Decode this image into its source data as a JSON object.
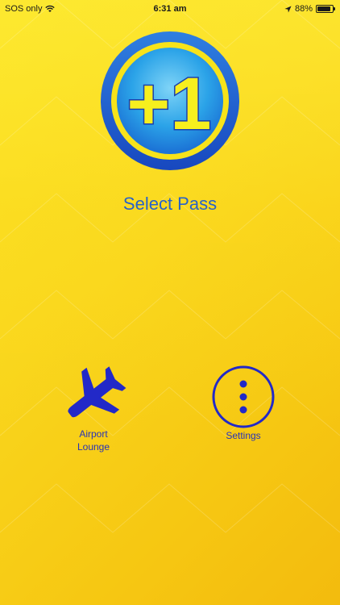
{
  "status_bar": {
    "carrier": "SOS only",
    "time": "6:31 am",
    "battery_percent": "88%",
    "battery_level": 0.88
  },
  "logo": {
    "text": "+1",
    "colors": {
      "ring_outer": "#1e5fd0",
      "ring_mid": "#f7e31a",
      "inner": "#2ba3e8",
      "text": "#f7ef1e"
    }
  },
  "main": {
    "title": "Select Pass"
  },
  "tiles": [
    {
      "label": "Airport\nLounge",
      "icon": "airplane-icon"
    },
    {
      "label": "Settings",
      "icon": "more-vertical-circle-icon"
    }
  ],
  "colors": {
    "background_top": "#fbe021",
    "background_bottom": "#f3bb0e",
    "title": "#2862c9",
    "icon_blue": "#2229c8"
  }
}
